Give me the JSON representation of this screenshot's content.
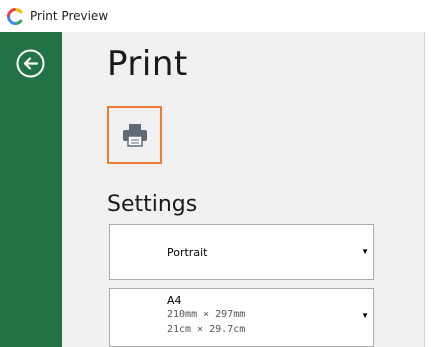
{
  "window": {
    "title": "Print Preview",
    "logo_icon": "app-logo-icon"
  },
  "sidebar": {
    "back_icon": "back-arrow-icon",
    "background_color": "#217346"
  },
  "main": {
    "title": "Print",
    "print_button_icon": "printer-icon",
    "print_button_border_color": "#ed7d31",
    "settings_heading": "Settings"
  },
  "settings": {
    "orientation": {
      "value": "Portrait",
      "arrow_icon": "dropdown-arrow-icon"
    },
    "paper": {
      "name": "A4",
      "size_mm": "210mm × 297mm",
      "size_cm": "21cm × 29.7cm",
      "arrow_icon": "dropdown-arrow-icon"
    }
  },
  "arrow_glyph": "▼"
}
